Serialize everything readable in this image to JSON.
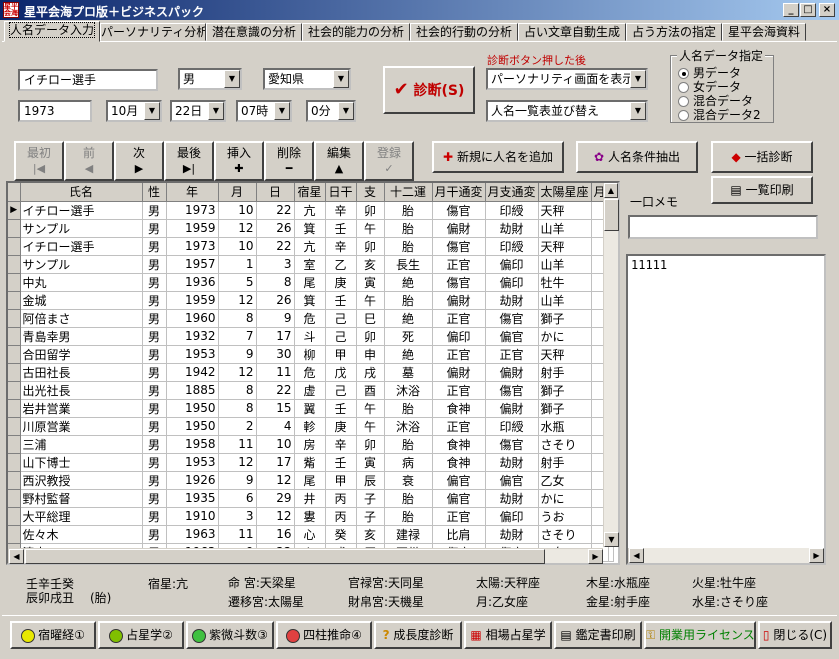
{
  "window": {
    "title": "星平会海プロ版＋ビジネスパック",
    "icon_text": "星平会海"
  },
  "tabs": [
    "人名データ入力",
    "パーソナリティ分析",
    "潜在意識の分析",
    "社会的能力の分析",
    "社会的行動の分析",
    "占い文章自動生成",
    "占う方法の指定",
    "星平会海資料"
  ],
  "form": {
    "name": "イチロー選手",
    "gender": "男",
    "pref": "愛知県",
    "year": "1973",
    "month": "10月",
    "day": "22日",
    "hour": "07時",
    "minute": "0分",
    "diagnose_label": "診断(S)",
    "after_label": "診断ボタン押した後",
    "after_value1": "パーソナリティ画面を表示",
    "after_value2": "人名一覧表並び替え"
  },
  "data_select": {
    "legend": "人名データ指定",
    "options": [
      "男データ",
      "女データ",
      "混合データ",
      "混合データ2"
    ],
    "selected": 0
  },
  "nav": [
    {
      "label": "最初",
      "sym": "|◀",
      "enabled": false
    },
    {
      "label": "前",
      "sym": "◀",
      "enabled": false
    },
    {
      "label": "次",
      "sym": "▶",
      "enabled": true
    },
    {
      "label": "最後",
      "sym": "▶|",
      "enabled": true
    },
    {
      "label": "挿入",
      "sym": "✚",
      "enabled": true
    },
    {
      "label": "削除",
      "sym": "━",
      "enabled": true
    },
    {
      "label": "編集",
      "sym": "▲",
      "enabled": true
    },
    {
      "label": "登録",
      "sym": "✓",
      "enabled": false
    }
  ],
  "actions": {
    "add_new": "新規に人名を追加",
    "extract": "人名条件抽出",
    "batch": "一括診断",
    "print_list": "一覧印刷",
    "memo_label": "一口メモ",
    "memo_text": "11111"
  },
  "grid": {
    "columns": [
      "氏名",
      "性",
      "年",
      "月",
      "日",
      "宿星",
      "日干",
      "支",
      "十二運",
      "月干通変",
      "月支通変",
      "太陽星座",
      "月"
    ],
    "rows": [
      [
        "イチロー選手",
        "男",
        "1973",
        "10",
        "22",
        "亢",
        "辛",
        "卯",
        "胎",
        "傷官",
        "印綬",
        "天秤"
      ],
      [
        "サンプル",
        "男",
        "1959",
        "12",
        "26",
        "箕",
        "壬",
        "午",
        "胎",
        "偏財",
        "劫財",
        "山羊"
      ],
      [
        "イチロー選手",
        "男",
        "1973",
        "10",
        "22",
        "亢",
        "辛",
        "卯",
        "胎",
        "傷官",
        "印綬",
        "天秤"
      ],
      [
        "サンプル",
        "男",
        "1957",
        "1",
        "3",
        "室",
        "乙",
        "亥",
        "長生",
        "正官",
        "偏印",
        "山羊"
      ],
      [
        "中丸",
        "男",
        "1936",
        "5",
        "8",
        "尾",
        "庚",
        "寅",
        "絶",
        "傷官",
        "偏印",
        "牡牛"
      ],
      [
        "金城",
        "男",
        "1959",
        "12",
        "26",
        "箕",
        "壬",
        "午",
        "胎",
        "偏財",
        "劫財",
        "山羊"
      ],
      [
        "阿倍まさ",
        "男",
        "1960",
        "8",
        "9",
        "危",
        "己",
        "巳",
        "絶",
        "正官",
        "傷官",
        "獅子"
      ],
      [
        "青島幸男",
        "男",
        "1932",
        "7",
        "17",
        "斗",
        "己",
        "卯",
        "死",
        "偏印",
        "偏官",
        "かに"
      ],
      [
        "合田留学",
        "男",
        "1953",
        "9",
        "30",
        "柳",
        "甲",
        "申",
        "絶",
        "正官",
        "正官",
        "天秤"
      ],
      [
        "古田社長",
        "男",
        "1942",
        "12",
        "11",
        "危",
        "戊",
        "戌",
        "墓",
        "偏財",
        "偏財",
        "射手"
      ],
      [
        "出光社長",
        "男",
        "1885",
        "8",
        "22",
        "虚",
        "己",
        "酉",
        "沐浴",
        "正官",
        "傷官",
        "獅子"
      ],
      [
        "岩井営業",
        "男",
        "1950",
        "8",
        "15",
        "翼",
        "壬",
        "午",
        "胎",
        "食神",
        "偏財",
        "獅子"
      ],
      [
        "川原営業",
        "男",
        "1950",
        "2",
        "4",
        "軫",
        "庚",
        "午",
        "沐浴",
        "正官",
        "印綬",
        "水瓶"
      ],
      [
        "三浦",
        "男",
        "1958",
        "11",
        "10",
        "房",
        "辛",
        "卯",
        "胎",
        "食神",
        "傷官",
        "さそり"
      ],
      [
        "山下博士",
        "男",
        "1953",
        "12",
        "17",
        "觜",
        "壬",
        "寅",
        "病",
        "食神",
        "劫財",
        "射手"
      ],
      [
        "西沢教授",
        "男",
        "1926",
        "9",
        "12",
        "尾",
        "甲",
        "辰",
        "衰",
        "偏官",
        "偏官",
        "乙女"
      ],
      [
        "野村監督",
        "男",
        "1935",
        "6",
        "29",
        "井",
        "丙",
        "子",
        "胎",
        "偏官",
        "劫財",
        "かに"
      ],
      [
        "大平総理",
        "男",
        "1910",
        "3",
        "12",
        "婁",
        "丙",
        "子",
        "胎",
        "正官",
        "偏印",
        "うお"
      ],
      [
        "佐々木",
        "男",
        "1963",
        "11",
        "16",
        "心",
        "癸",
        "亥",
        "建禄",
        "比肩",
        "劫財",
        "さそり"
      ],
      [
        "清水",
        "男",
        "1963",
        "9",
        "22",
        "心",
        "戊",
        "辰",
        "冠帯",
        "傷官",
        "傷官",
        "乙女"
      ]
    ]
  },
  "info": {
    "stem": "壬辛壬癸",
    "branch": "辰卯戌丑",
    "branch_note": "(胎)",
    "shuku": "宿星:亢",
    "mei": "命 宮:天梁星",
    "kanroku": "官禄宮:天同星",
    "seni": "遷移宮:太陽星",
    "zaihaku": "財帛宮:天機星",
    "sun": "太陽:天秤座",
    "moon": "月:乙女座",
    "jupiter": "木星:水瓶座",
    "venus": "金星:射手座",
    "mars": "火星:牡牛座",
    "mercury": "水星:さそり座"
  },
  "bottom": [
    "宿曜経①",
    "占星学②",
    "紫微斗数③",
    "四柱推命④",
    "成長度診断",
    "相場占星学",
    "鑑定書印刷",
    "開業用ライセンス",
    "閉じる(C)"
  ],
  "colors": {
    "license_text": "#008000",
    "diagnose_check": "#c00000",
    "label_red": "#c00000"
  }
}
